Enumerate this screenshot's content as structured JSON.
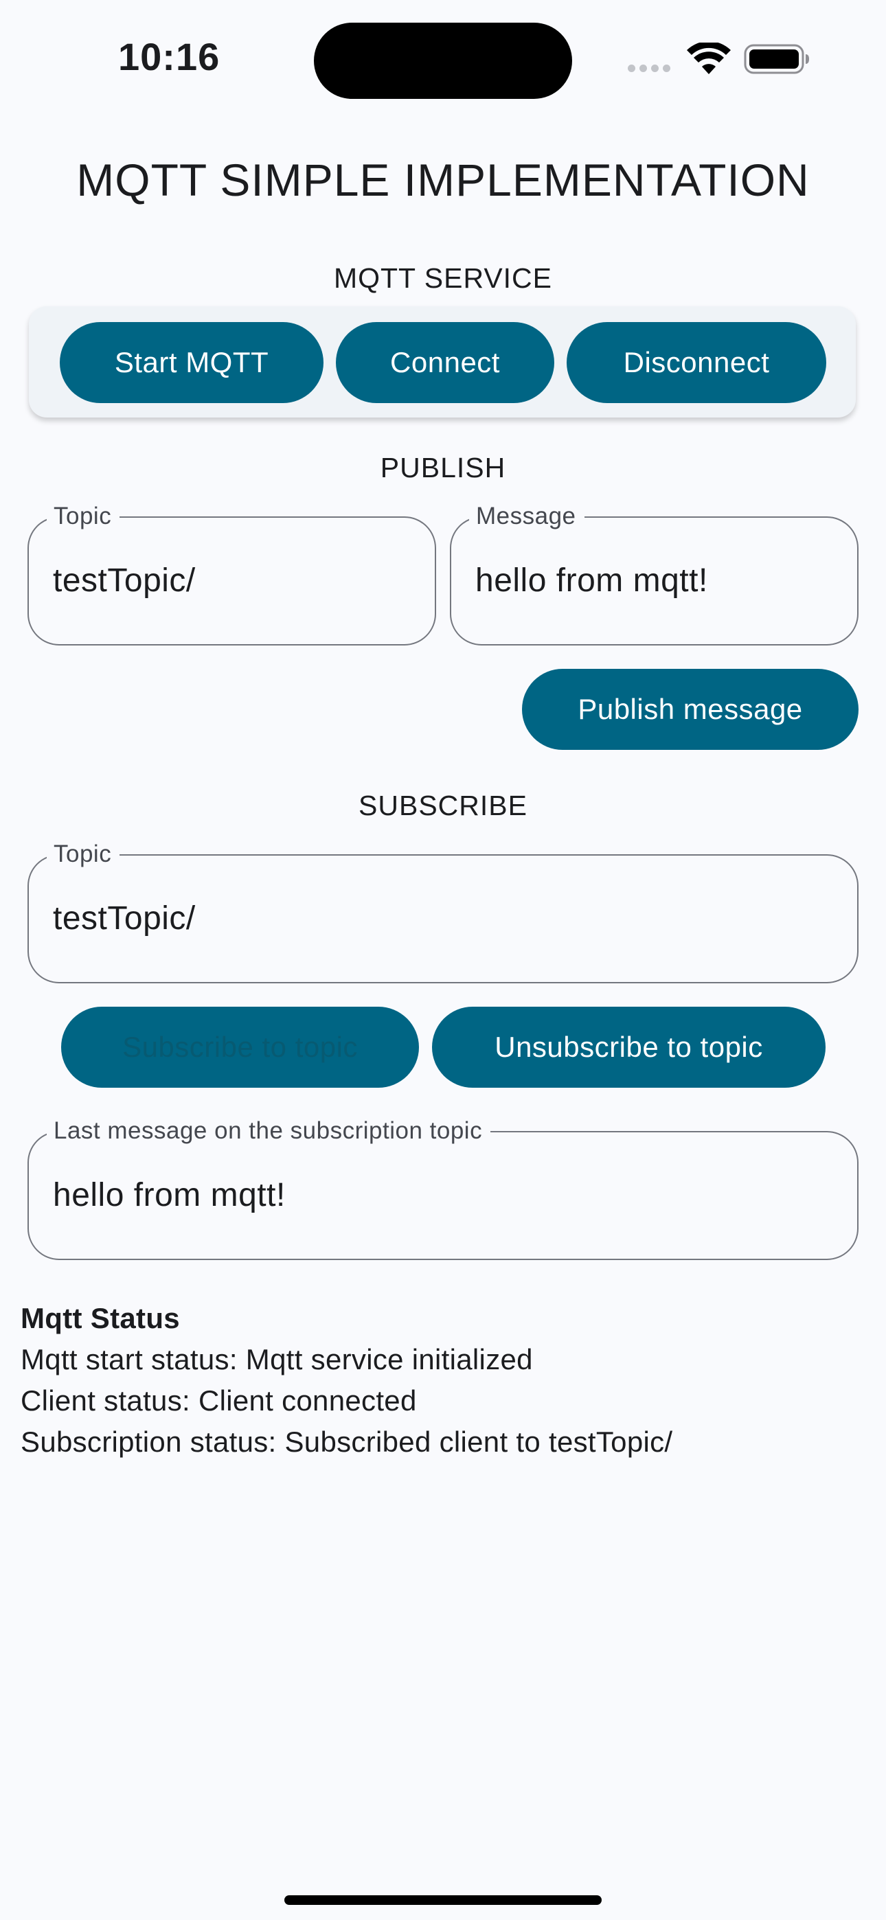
{
  "status_bar": {
    "time": "10:16",
    "icons": [
      "cellular-signal-icon",
      "wifi-icon",
      "battery-icon"
    ]
  },
  "app": {
    "title": "MQTT SIMPLE IMPLEMENTATION",
    "accent_color": "#006584"
  },
  "service": {
    "section_title": "MQTT SERVICE",
    "start_label": "Start MQTT",
    "connect_label": "Connect",
    "disconnect_label": "Disconnect"
  },
  "publish": {
    "section_title": "PUBLISH",
    "topic_label": "Topic",
    "topic_value": "testTopic/",
    "message_label": "Message",
    "message_value": "hello from mqtt!",
    "publish_label": "Publish message"
  },
  "subscribe": {
    "section_title": "SUBSCRIBE",
    "topic_label": "Topic",
    "topic_value": "testTopic/",
    "subscribe_label": "Subscribe to topic",
    "subscribe_enabled": false,
    "unsubscribe_label": "Unsubscribe to topic",
    "last_message_label": "Last message on the subscription topic",
    "last_message_value": "hello from mqtt!"
  },
  "status": {
    "heading": "Mqtt Status",
    "start_status": "Mqtt start status: Mqtt service initialized",
    "client_status": "Client status: Client connected",
    "subscription_status": "Subscription status: Subscribed client to testTopic/"
  }
}
